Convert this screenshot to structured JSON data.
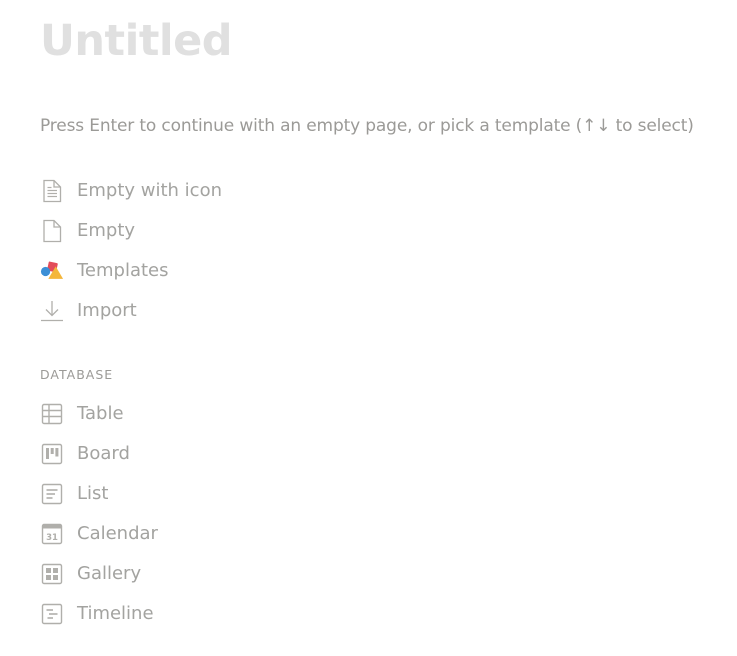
{
  "page": {
    "title": "Untitled",
    "hint": "Press Enter to continue with an empty page, or pick a template (↑↓ to select)"
  },
  "menu": [
    {
      "label": "Empty with icon",
      "icon": "page-with-text-icon"
    },
    {
      "label": "Empty",
      "icon": "blank-page-icon"
    },
    {
      "label": "Templates",
      "icon": "templates-shapes-icon"
    },
    {
      "label": "Import",
      "icon": "download-arrow-icon"
    }
  ],
  "database": {
    "heading": "DATABASE",
    "items": [
      {
        "label": "Table",
        "icon": "table-icon"
      },
      {
        "label": "Board",
        "icon": "board-icon"
      },
      {
        "label": "List",
        "icon": "list-icon"
      },
      {
        "label": "Calendar",
        "icon": "calendar-icon",
        "icon_text": "31"
      },
      {
        "label": "Gallery",
        "icon": "gallery-icon"
      },
      {
        "label": "Timeline",
        "icon": "timeline-icon"
      }
    ]
  },
  "colors": {
    "title": "#e0e0e0",
    "text": "#9b9a97",
    "icon": "#b0afab",
    "templates_red": "#e34c5a",
    "templates_blue": "#3c8fd6",
    "templates_yellow": "#f4b63b"
  }
}
